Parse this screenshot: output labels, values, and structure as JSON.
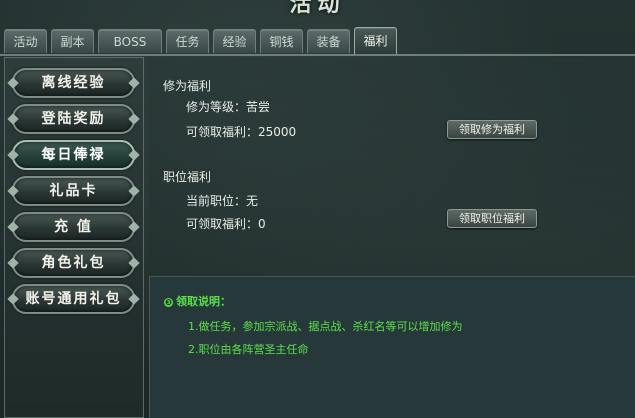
{
  "window": {
    "title": "活动"
  },
  "tabs": [
    {
      "label": "活动",
      "active": false
    },
    {
      "label": "副本",
      "active": false
    },
    {
      "label": "BOSS",
      "active": false
    },
    {
      "label": "任务",
      "active": false
    },
    {
      "label": "经验",
      "active": false
    },
    {
      "label": "铜钱",
      "active": false
    },
    {
      "label": "装备",
      "active": false
    },
    {
      "label": "福利",
      "active": true
    }
  ],
  "sidebar": {
    "items": [
      {
        "label": "离线经验"
      },
      {
        "label": "登陆奖励"
      },
      {
        "label": "每日俸禄",
        "active": true
      },
      {
        "label": "礼品卡"
      },
      {
        "label": "充 值"
      },
      {
        "label": "角色礼包"
      },
      {
        "label": "账号通用礼包"
      }
    ]
  },
  "cultivation": {
    "title": "修为福利",
    "level_label": "修为等级：苦尝",
    "reward_label": "可领取福利：25000",
    "button": "领取修为福利"
  },
  "position": {
    "title": "职位福利",
    "current_label": "当前职位：无",
    "reward_label": "可领取福利：0",
    "button": "领取职位福利"
  },
  "notes": {
    "bullet": "❸",
    "title": "领取说明：",
    "lines": [
      "1.做任务，参加宗派战、据点战、杀红名等可以增加修为",
      "2.职位由各阵营圣主任命"
    ]
  }
}
